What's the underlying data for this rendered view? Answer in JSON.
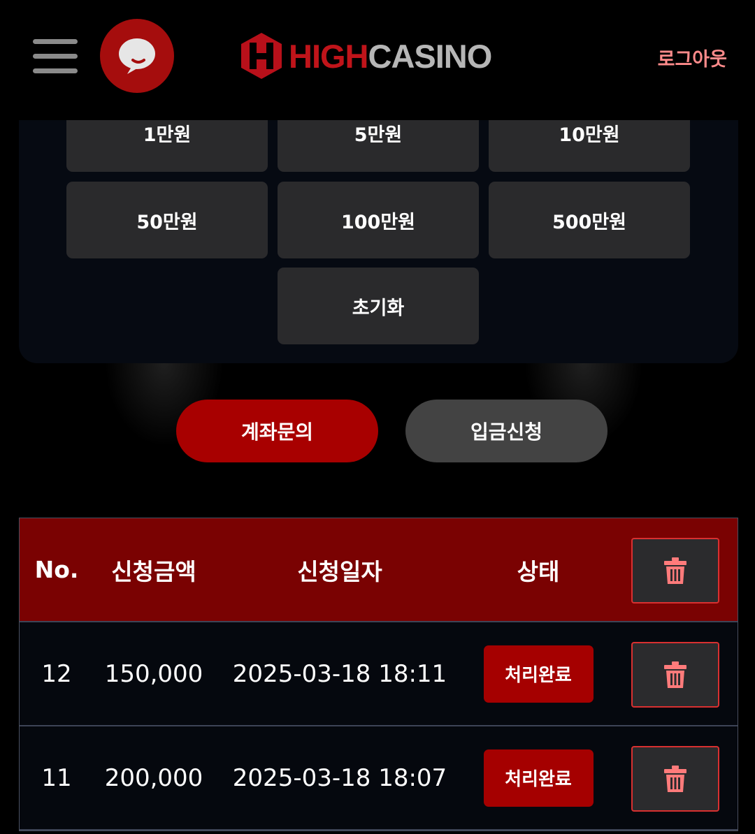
{
  "header": {
    "brand_high": "HIGH",
    "brand_casino": "CASINO",
    "logout_label": "로그아웃",
    "menu_icon": "hamburger-icon",
    "chat_icon": "chat-bubble-icon"
  },
  "amounts": {
    "b1": "1만원",
    "b5": "5만원",
    "b10": "10만원",
    "b50": "50만원",
    "b100": "100만원",
    "b500": "500만원",
    "reset": "초기화"
  },
  "tabs": {
    "account_inquiry": "계좌문의",
    "deposit_request": "입금신청"
  },
  "table": {
    "headers": {
      "no": "No.",
      "amount": "신청금액",
      "date": "신청일자",
      "status": "상태"
    },
    "rows": [
      {
        "no": "12",
        "amount": "150,000",
        "date": "2025-03-18 18:11",
        "status": "처리완료"
      },
      {
        "no": "11",
        "amount": "200,000",
        "date": "2025-03-18 18:07",
        "status": "처리완료"
      }
    ]
  },
  "colors": {
    "accent_red": "#a80000",
    "header_row": "#7a0202",
    "logout_pink": "#ff8b8b",
    "trash_icon": "#ff7b7b"
  }
}
